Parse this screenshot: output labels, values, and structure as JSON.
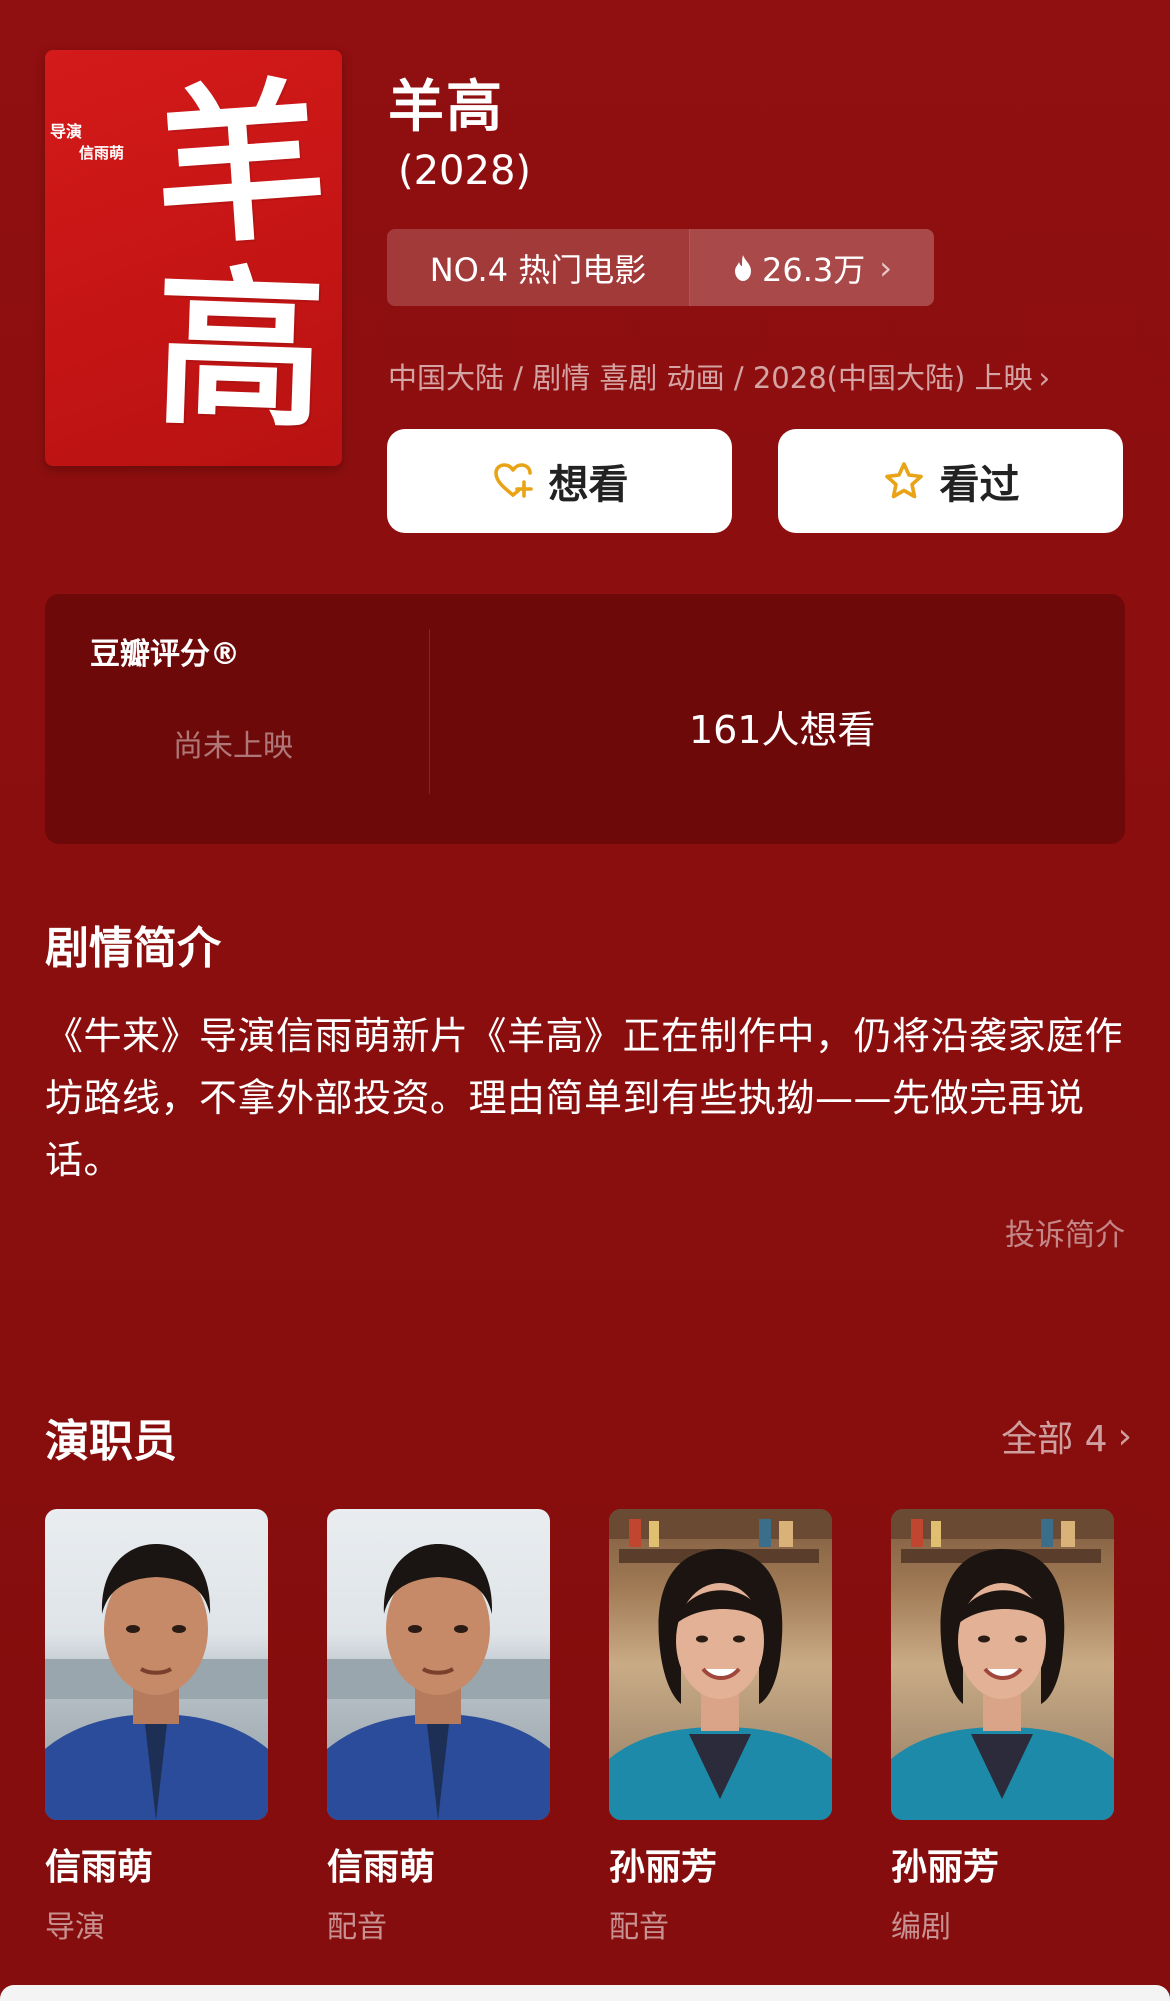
{
  "movie": {
    "title": "羊高",
    "year": "(2028)",
    "rank": "NO.4 热门电影",
    "heat": "26.3万",
    "meta": "中国大陆 / 剧情 喜剧 动画 / 2028(中国大陆) 上映",
    "poster": {
      "title_char_1": "羊",
      "title_char_2": "高",
      "credit_role": "导演",
      "credit_name": "信雨萌"
    }
  },
  "actions": {
    "want_label": "想看",
    "seen_label": "看过"
  },
  "rating": {
    "label": "豆瓣评分®",
    "status": "尚未上映",
    "want_count": "161人想看"
  },
  "synopsis": {
    "title": "剧情简介",
    "text": "《牛来》导演信雨萌新片《羊高》正在制作中，仍将沿袭家庭作坊路线，不拿外部投资。理由简单到有些执拗——先做完再说话。",
    "report_label": "投诉简介"
  },
  "cast": {
    "title": "演职员",
    "all_label": "全部 4",
    "members": [
      {
        "name": "信雨萌",
        "role": "导演"
      },
      {
        "name": "信雨萌",
        "role": "配音"
      },
      {
        "name": "孙丽芳",
        "role": "配音"
      },
      {
        "name": "孙丽芳",
        "role": "编剧"
      }
    ]
  },
  "colors": {
    "background": "#8c0f0f",
    "card": "#6e0909",
    "poster": "#c41414",
    "button_icon": "#e8a317"
  }
}
